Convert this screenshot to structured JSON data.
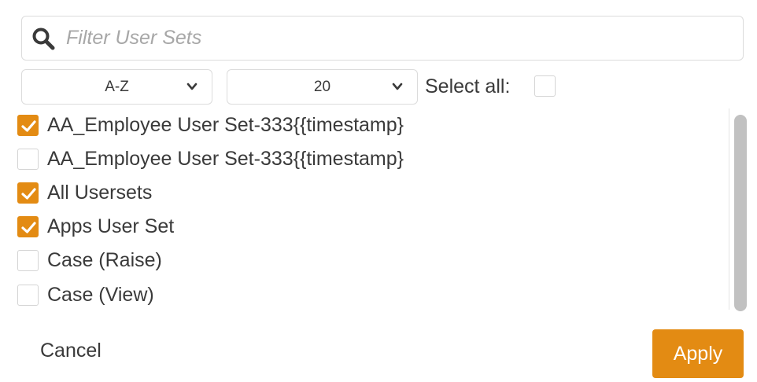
{
  "search": {
    "placeholder": "Filter User Sets",
    "value": ""
  },
  "controls": {
    "sort_value": "A-Z",
    "per_page_value": "20",
    "select_all_label": "Select all:",
    "select_all_checked": false
  },
  "list": {
    "items": [
      {
        "label": "AA_Employee User Set-333{{timestamp}",
        "checked": true
      },
      {
        "label": "AA_Employee User Set-333{{timestamp}",
        "checked": false
      },
      {
        "label": "All Usersets",
        "checked": true
      },
      {
        "label": "Apps User Set",
        "checked": true
      },
      {
        "label": "Case (Raise)",
        "checked": false
      },
      {
        "label": "Case (View)",
        "checked": false
      }
    ]
  },
  "footer": {
    "cancel_label": "Cancel",
    "apply_label": "Apply"
  },
  "colors": {
    "accent": "#e38b13",
    "text": "#3a3a3a",
    "border": "#dcdcdc",
    "placeholder": "#a7a7a7"
  }
}
